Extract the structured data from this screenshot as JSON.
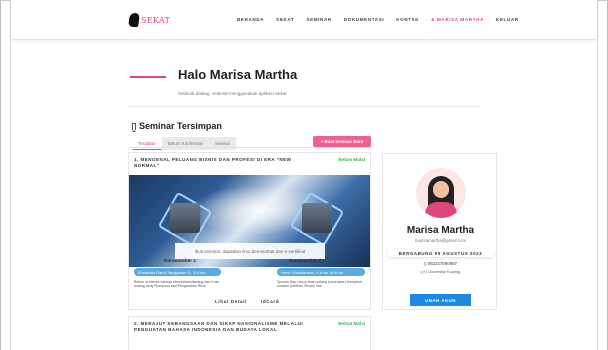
{
  "brand": {
    "logo_text": "SEKAT"
  },
  "nav": {
    "items": [
      "BERANDA",
      "SEKAT",
      "SEMINAR",
      "DOKUMENTASI",
      "KONTAK",
      "& MARISA MARTHA",
      "KELUAR"
    ],
    "active_index": 5
  },
  "greeting": {
    "title": "Halo Marisa Martha",
    "subtitle": "Selamat datang, selamat menggunakan aplikasi Sekat"
  },
  "saved": {
    "title": "Seminar Tersimpan",
    "tabs": [
      "Terdaftar",
      "Belum Konfirmasi",
      "Selesai"
    ],
    "active_tab": 0,
    "new_button": "+ Buat Seminar Baru"
  },
  "seminars": [
    {
      "title": "1. MENGENAL PELUANG BISNIS DAN PROFESI DI ERA \"NEW NORMAL\"",
      "status": "Belum Mulai",
      "overlay": "Ikuti seminar, dapatkan ilmu bermanfaat dan e-sertifikat",
      "speaker_label": "Narasumber 1",
      "speaker_label_2": "Narasumber 2",
      "speaker1_name": "Eduardus Dario Tanggalam S., S.Kom",
      "speaker2_name": "Henri Christianson, S.Kom, M.Kom",
      "speaker1_desc": "Beliau ia interes kahaya Mendalamidisdang dan Kuta dalang muly Rumpusu bad Pengalahan Rina.",
      "speaker2_desc": "Sposok Bap Husul anan salang jesuenssa Deseplech lunaaru platform Simply dan",
      "links": [
        "Lihat Detail",
        "IdCard"
      ]
    },
    {
      "title": "2. MERAJUT KEBANGSAAN DAN SIKAP NASIONALISME MELALUI PENGUATAN BAHASA INDONESIA DAN BUDAYA LOKAL",
      "status": "Belum Mulai"
    }
  ],
  "profile": {
    "name": "Marisa Martha",
    "email": "marisamartha@gmail.com",
    "since": "BERGABUNG 09 AGUSTUS 2023",
    "phone": "082237890987",
    "jobs": "[ e ] Universitiy Kupang",
    "button": "UBAH AKUN"
  },
  "colors": {
    "accent": "#e0457b",
    "button_pink": "#f0608f",
    "button_blue": "#1e88e5",
    "status_green": "#3bb34a",
    "badge_blue": "#5aaae0"
  }
}
